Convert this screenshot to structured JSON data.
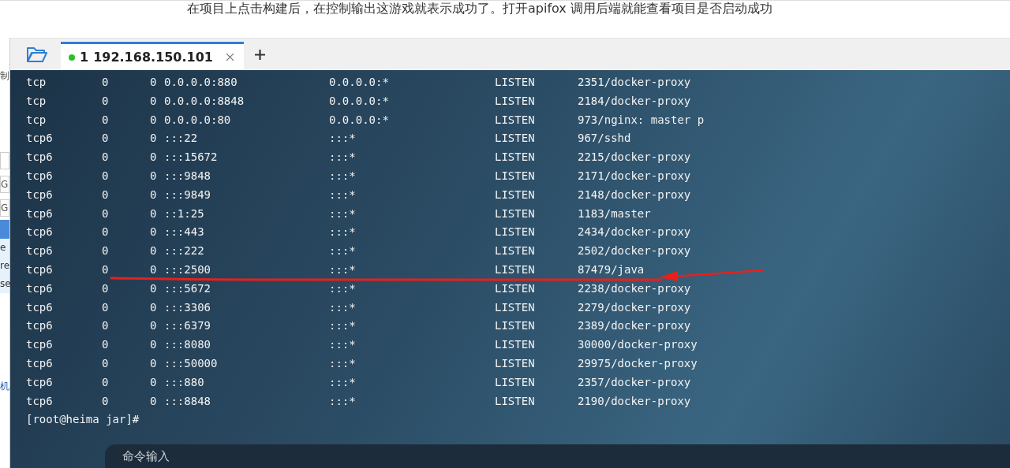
{
  "article_line": "在项目上点击构建后，在控制输出这游戏就表示成功了。打开apifox 调用后端就能查看项目是否启动成功",
  "side_fragments": [
    {
      "kind": "label",
      "text": "制"
    },
    {
      "kind": "field"
    },
    {
      "kind": "field",
      "text": "G"
    },
    {
      "kind": "field",
      "text": "G"
    },
    {
      "kind": "header"
    },
    {
      "kind": "row",
      "text": "e"
    },
    {
      "kind": "row",
      "text": "re"
    },
    {
      "kind": "row",
      "text": "se"
    },
    {
      "kind": "label",
      "text": "机"
    }
  ],
  "tabs": [
    {
      "index": "1",
      "host": "192.168.150.101",
      "selected": true,
      "color": "#2bc02b"
    }
  ],
  "terminal": {
    "rows": [
      [
        "tcp",
        "0",
        "0",
        "0.0.0.0:880",
        "0.0.0.0:*",
        "LISTEN",
        "2351/docker-proxy"
      ],
      [
        "tcp",
        "0",
        "0",
        "0.0.0.0:8848",
        "0.0.0.0:*",
        "LISTEN",
        "2184/docker-proxy"
      ],
      [
        "tcp",
        "0",
        "0",
        "0.0.0.0:80",
        "0.0.0.0:*",
        "LISTEN",
        "973/nginx: master p"
      ],
      [
        "tcp6",
        "0",
        "0",
        ":::22",
        ":::*",
        "LISTEN",
        "967/sshd"
      ],
      [
        "tcp6",
        "0",
        "0",
        ":::15672",
        ":::*",
        "LISTEN",
        "2215/docker-proxy"
      ],
      [
        "tcp6",
        "0",
        "0",
        ":::9848",
        ":::*",
        "LISTEN",
        "2171/docker-proxy"
      ],
      [
        "tcp6",
        "0",
        "0",
        ":::9849",
        ":::*",
        "LISTEN",
        "2148/docker-proxy"
      ],
      [
        "tcp6",
        "0",
        "0",
        "::1:25",
        ":::*",
        "LISTEN",
        "1183/master"
      ],
      [
        "tcp6",
        "0",
        "0",
        ":::443",
        ":::*",
        "LISTEN",
        "2434/docker-proxy"
      ],
      [
        "tcp6",
        "0",
        "0",
        ":::222",
        ":::*",
        "LISTEN",
        "2502/docker-proxy"
      ],
      [
        "tcp6",
        "0",
        "0",
        ":::2500",
        ":::*",
        "LISTEN",
        "87479/java"
      ],
      [
        "tcp6",
        "0",
        "0",
        ":::5672",
        ":::*",
        "LISTEN",
        "2238/docker-proxy"
      ],
      [
        "tcp6",
        "0",
        "0",
        ":::3306",
        ":::*",
        "LISTEN",
        "2279/docker-proxy"
      ],
      [
        "tcp6",
        "0",
        "0",
        ":::6379",
        ":::*",
        "LISTEN",
        "2389/docker-proxy"
      ],
      [
        "tcp6",
        "0",
        "0",
        ":::8080",
        ":::*",
        "LISTEN",
        "30000/docker-proxy"
      ],
      [
        "tcp6",
        "0",
        "0",
        ":::50000",
        ":::*",
        "LISTEN",
        "29975/docker-proxy"
      ],
      [
        "tcp6",
        "0",
        "0",
        ":::880",
        ":::*",
        "LISTEN",
        "2357/docker-proxy"
      ],
      [
        "tcp6",
        "0",
        "0",
        ":::8848",
        ":::*",
        "LISTEN",
        "2190/docker-proxy"
      ]
    ],
    "prompt": "[root@heima jar]#"
  },
  "command_input": {
    "placeholder": "命令输入"
  }
}
